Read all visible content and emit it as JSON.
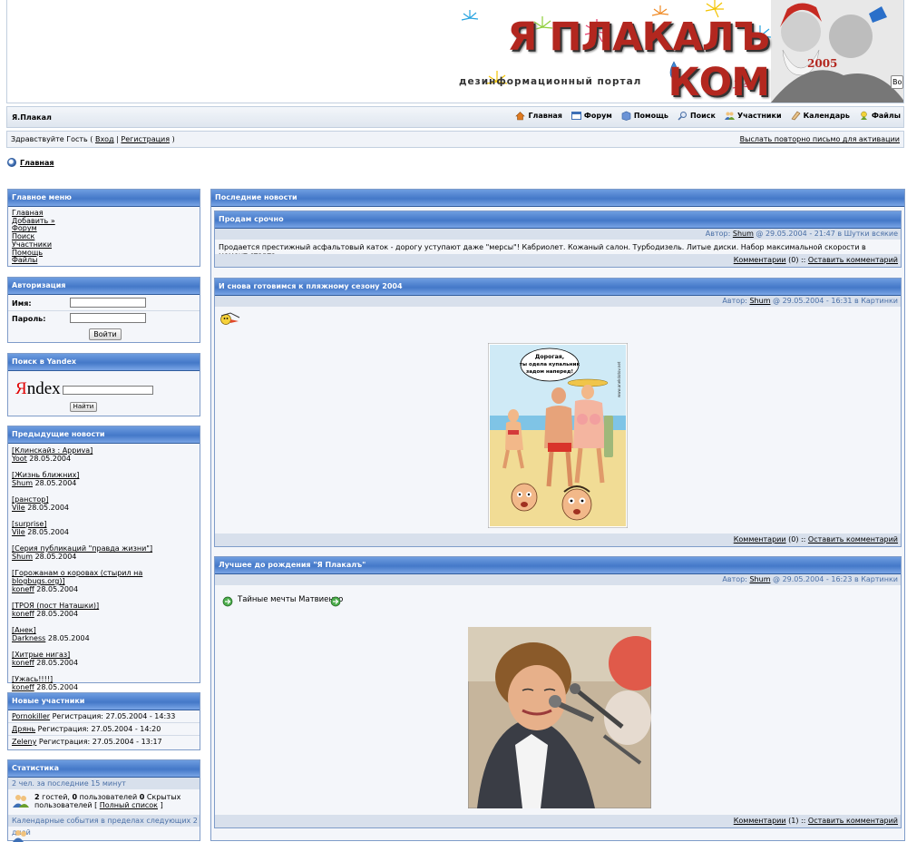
{
  "banner": {
    "logo_text": "Я ПЛАКАЛЪ КОМ",
    "tagline": "дезинформационный портал",
    "year": "2005",
    "tooltip": "Воз"
  },
  "navbar": {
    "site_title": "Я.Плакал",
    "links": [
      {
        "label": "Главная",
        "icon": "home-icon",
        "color": "#e07a20"
      },
      {
        "label": "Форум",
        "icon": "forum-icon",
        "color": "#3d6fb6"
      },
      {
        "label": "Помощь",
        "icon": "help-icon",
        "color": "#3d6fb6"
      },
      {
        "label": "Поиск",
        "icon": "search-icon",
        "color": "#4a6fa6"
      },
      {
        "label": "Участники",
        "icon": "members-icon",
        "color": "#3d6fb6"
      },
      {
        "label": "Календарь",
        "icon": "calendar-icon",
        "color": "#c08a3a"
      },
      {
        "label": "Файлы",
        "icon": "files-icon",
        "color": "#6aa02c"
      }
    ]
  },
  "userbar": {
    "greeting_prefix": "Здравствуйте Гость (",
    "login": "Вход",
    "separator": "|",
    "register": "Регистрация",
    "greeting_suffix": ")",
    "resend_activation": "Выслать повторно письмо для активации"
  },
  "breadcrumb": {
    "label": "Главная"
  },
  "main_menu": {
    "title": "Главное меню",
    "items": [
      "Главная",
      "Добавить »",
      "Форум",
      "Поиск",
      "Участники",
      "Помощь",
      "Файлы"
    ]
  },
  "auth": {
    "title": "Авторизация",
    "name_label": "Имя:",
    "password_label": "Пароль:",
    "submit": "Войти"
  },
  "yandex": {
    "title": "Поиск в Yandex",
    "logo_first": "Я",
    "logo_rest": "ndex",
    "submit": "Найти"
  },
  "prev_news": {
    "title": "Предыдущие новости",
    "items": [
      {
        "title": "[Клинскайз : Арриva]",
        "author": "Yoot",
        "date": "28.05.2004"
      },
      {
        "title": "[Жизнь ближних]",
        "author": "Shum",
        "date": "28.05.2004"
      },
      {
        "title": "[ранстор]",
        "author": "Vile",
        "date": "28.05.2004"
      },
      {
        "title": "[surprise]",
        "author": "Vile",
        "date": "28.05.2004"
      },
      {
        "title": "[Серия публикаций \"правда жизни\"]",
        "author": "Shum",
        "date": "28.05.2004"
      },
      {
        "title": "[Горожанам о коровах (стырил на blogbugs.org)]",
        "author": "koneff",
        "date": "28.05.2004"
      },
      {
        "title": "[ТРОЯ (пост Наташки)]",
        "author": "koneff",
        "date": "28.05.2004"
      },
      {
        "title": "[Анек]",
        "author": "Darkness",
        "date": "28.05.2004"
      },
      {
        "title": "[Хитрые нигаз]",
        "author": "koneff",
        "date": "28.05.2004"
      },
      {
        "title": "[Ужась!!!!]",
        "author": "koneff",
        "date": "28.05.2004"
      }
    ]
  },
  "new_members": {
    "title": "Новые участники",
    "items": [
      {
        "name": "Pornokiller",
        "text": "Регистрация: 27.05.2004 - 14:33"
      },
      {
        "name": "Дрянь",
        "text": "Регистрация: 27.05.2004 - 14:20"
      },
      {
        "name": "Zeleny",
        "text": "Регистрация: 27.05.2004 - 13:17"
      }
    ]
  },
  "stats": {
    "title": "Статистика",
    "online_caption": "2 чел. за последние 15 минут",
    "guests_count": "2",
    "guests_text": "гостей,",
    "users_count": "0",
    "users_text": "пользователей",
    "hidden_count": "0",
    "hidden_text": "Скрытых",
    "hidden_text2": "пользователей [",
    "full_list": "Полный список",
    "list_end": "]",
    "calendar_caption": "Календарные события в пределах следующих 2 дней"
  },
  "latest_news": {
    "title": "Последние новости",
    "posts": [
      {
        "title": "Продам срочно",
        "meta_prefix": "Автор:",
        "author": "Shum",
        "meta_suffix": "@ 29.05.2004 - 21:47 в Шутки всякие",
        "body": "Продается престижный асфальтовый каток - дорогу уступают даже \"мерсы\"! Кабриолет. Кожаный салон. Турбодизель. Литые диски. Набор максимальной скорости в момент старта.",
        "comments": "Комментарии",
        "comment_count": "(0) ::",
        "leave_comment": "Оставить комментарий"
      },
      {
        "title": "И снова готовимся к пляжному сезону 2004",
        "meta_prefix": "Автор:",
        "author": "Shum",
        "meta_suffix": "@ 29.05.2004 - 16:31 в Картинки",
        "image_caption_lines": [
          "Дорогая,",
          "ты одела купальник",
          "задом наперед!"
        ],
        "image_watermark": "www.anekdotov.net",
        "comments": "Комментарии",
        "comment_count": "(0) ::",
        "leave_comment": "Оставить комментарий"
      },
      {
        "title": "Лучшее до рождения \"Я Плакалъ\"",
        "meta_prefix": "Автор:",
        "author": "Shum",
        "meta_suffix": "@ 29.05.2004 - 16:23 в Картинки",
        "body": "Тайные мечты Матвиенко",
        "comments": "Комментарии",
        "comment_count": "(1) ::",
        "leave_comment": "Оставить комментарий"
      }
    ]
  }
}
